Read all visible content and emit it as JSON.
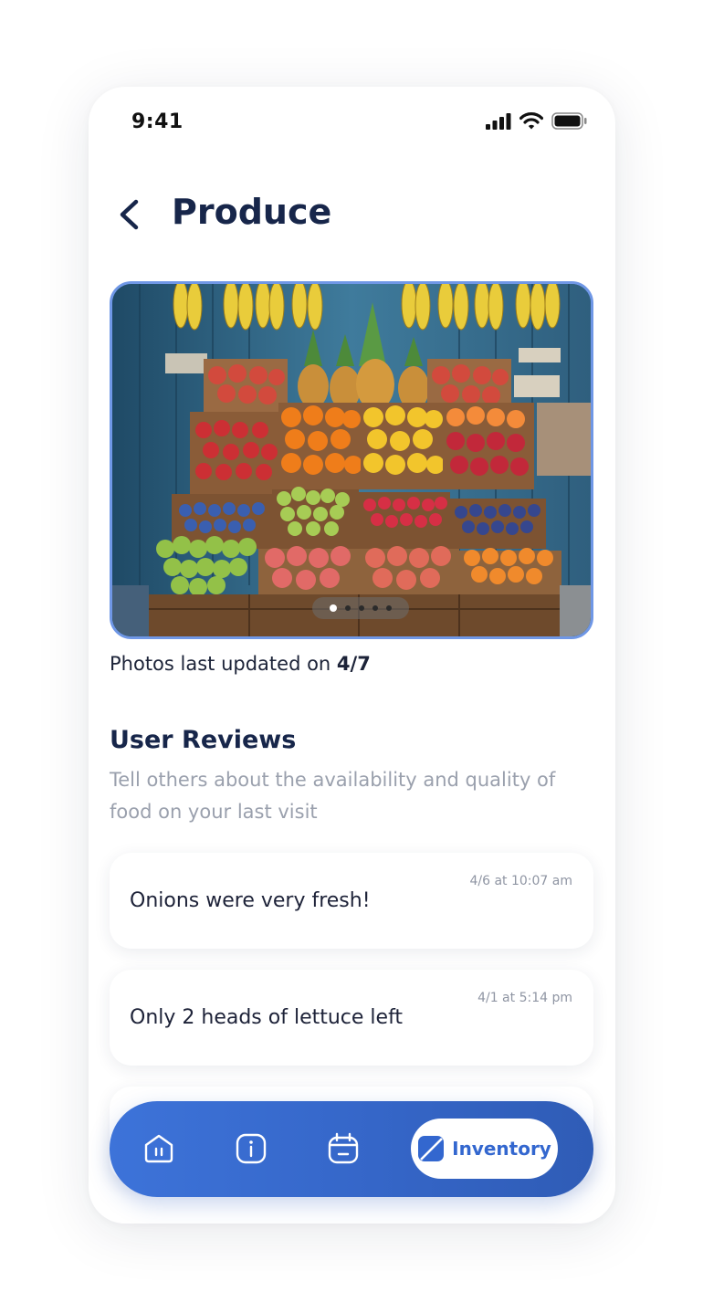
{
  "status": {
    "time": "9:41"
  },
  "header": {
    "title": "Produce"
  },
  "gallery": {
    "dots": 5,
    "active_index": 0,
    "updated_prefix": "Photos last updated on ",
    "updated_date": "4/7"
  },
  "reviews": {
    "title": "User Reviews",
    "subtitle": "Tell others about the availability and quality of food on your last visit",
    "items": [
      {
        "date": "4/6 at 10:07 am",
        "text": "Onions were very fresh!"
      },
      {
        "date": "4/1 at 5:14 pm",
        "text": "Only 2 heads of lettuce left"
      }
    ]
  },
  "nav": {
    "items": [
      {
        "icon": "home-icon"
      },
      {
        "icon": "info-icon"
      },
      {
        "icon": "calendar-icon"
      },
      {
        "icon": "inventory-icon",
        "label": "Inventory",
        "active": true
      }
    ]
  },
  "colors": {
    "primary": "#3367cf",
    "title": "#17264a",
    "muted": "#9aa0ad"
  }
}
